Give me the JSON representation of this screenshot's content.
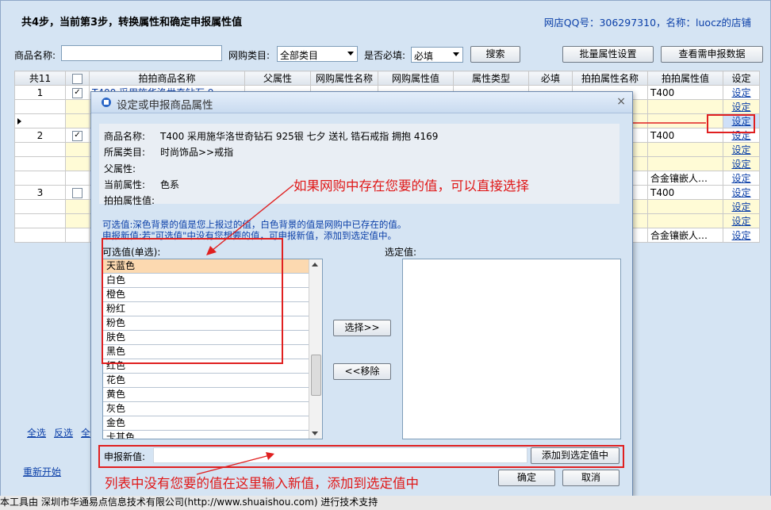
{
  "header": {
    "step_title": "共4步，当前第3步，转换属性和确定申报属性值",
    "shop_info": "网店QQ号：306297310，名称：luocz的店铺"
  },
  "filter": {
    "name_label": "商品名称:",
    "name_value": "",
    "category_label": "网购类目:",
    "category_value": "全部类目",
    "required_label": "是否必填:",
    "required_value": "必填",
    "search_button": "搜索",
    "batch_button": "批量属性设置",
    "view_button": "查看需申报数据"
  },
  "grid": {
    "columns": [
      "共11",
      "",
      "拍拍商品名称",
      "父属性",
      "网购属性名称",
      "网购属性值",
      "属性类型",
      "必填",
      "拍拍属性名称",
      "拍拍属性值",
      "设定"
    ],
    "rows": [
      {
        "num": "1",
        "check": true,
        "name": "T400 采用施华洛世奇钻石 9",
        "pp_value": "T400",
        "action": "设定",
        "yellow": false
      },
      {
        "num": "",
        "check": false,
        "name": "",
        "pp_value": "",
        "action": "设定",
        "yellow": true
      },
      {
        "num": "",
        "check": false,
        "name": "",
        "pp_value": "",
        "action": "设定",
        "yellow": true,
        "current": true
      },
      {
        "num": "2",
        "check": true,
        "name": "",
        "pp_value": "T400",
        "action": "设定",
        "yellow": false
      },
      {
        "num": "",
        "check": false,
        "name": "",
        "pp_value": "",
        "action": "设定",
        "yellow": true
      },
      {
        "num": "",
        "check": false,
        "name": "",
        "pp_value": "",
        "action": "设定",
        "yellow": true
      },
      {
        "num": "",
        "check": false,
        "name": "",
        "pp_value": "合金镶嵌人…",
        "action": "设定",
        "yellow": false
      },
      {
        "num": "3",
        "check": false,
        "name": "",
        "pp_value": "T400",
        "action": "设定",
        "yellow": false
      },
      {
        "num": "",
        "check": false,
        "name": "",
        "pp_value": "",
        "action": "设定",
        "yellow": true
      },
      {
        "num": "",
        "check": false,
        "name": "",
        "pp_value": "",
        "action": "设定",
        "yellow": true
      },
      {
        "num": "",
        "check": false,
        "name": "",
        "pp_value": "合金镶嵌人…",
        "action": "设定",
        "yellow": false
      }
    ]
  },
  "sidebar_links": {
    "select_all": "全选",
    "invert": "反选",
    "all2": "全",
    "restart": "重新开始"
  },
  "dialog": {
    "title": "设定或申报商品属性",
    "product_name_label": "商品名称:",
    "product_name_value": "T400 采用施华洛世奇钻石 925银 七夕 送礼 锆石戒指 拥抱 4169",
    "category_label": "所属类目:",
    "category_value": "时尚饰品>>戒指",
    "parent_label": "父属性:",
    "parent_value": "",
    "current_label": "当前属性:",
    "current_value": "色系",
    "pp_value_label": "拍拍属性值:",
    "pp_value": "",
    "note1": "可选值:深色背景的值是您上报过的值，白色背景的值是网购中已存在的值。",
    "note2": "申报新值:若\"可选值\"中没有您想要的值，可申报新值，添加到选定值中。",
    "options_label": "可选值(单选):",
    "selected_label": "选定值:",
    "options": [
      "天蓝色",
      "白色",
      "橙色",
      "粉红",
      "粉色",
      "肤色",
      "黑色",
      "红色",
      "花色",
      "黄色",
      "灰色",
      "金色",
      "卡其色"
    ],
    "select_button": "选择>>",
    "remove_button": "<<移除",
    "new_value_label": "申报新值:",
    "new_value": "",
    "add_button": "添加到选定值中",
    "ok_button": "确定",
    "cancel_button": "取消"
  },
  "annotations": {
    "top": "如果网购中存在您要的值，可以直接选择",
    "bottom": "列表中没有您要的值在这里输入新值，添加到选定值中"
  },
  "footer": "本工具由 深圳市华通易点信息技术有限公司(http://www.shuaishou.com) 进行技术支持",
  "colors": {
    "annotation_red": "#e02020",
    "link_blue": "#0b3fa8",
    "highlight": "#fcd9b0"
  }
}
